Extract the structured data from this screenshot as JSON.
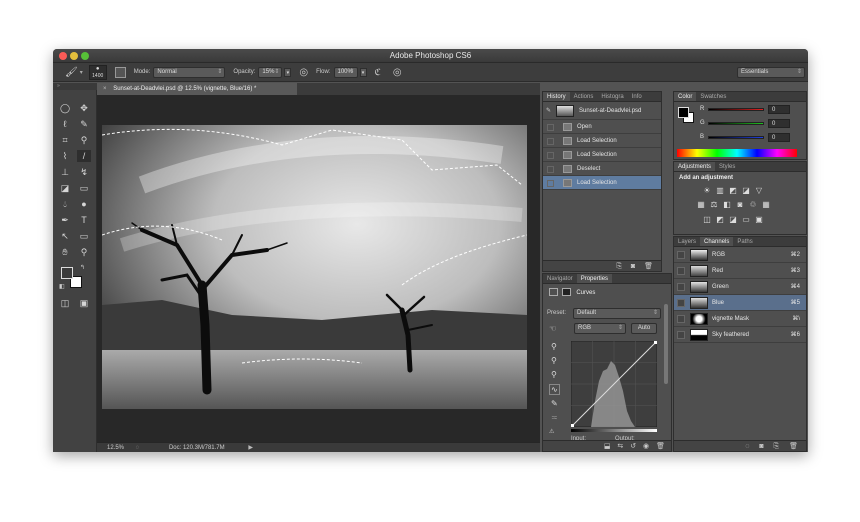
{
  "app": {
    "title": "Adobe Photoshop CS6"
  },
  "options": {
    "brush_size": "1400",
    "mode_label": "Mode:",
    "mode_value": "Normal",
    "opacity_label": "Opacity:",
    "opacity_value": "15%",
    "flow_label": "Flow:",
    "flow_value": "100%",
    "workspace": "Essentials"
  },
  "document": {
    "tab_title": "Sunset-at-Deadvlei.psd @ 12.5% (vignette, Blue/16) *",
    "close_glyph": "×"
  },
  "status": {
    "zoom": "12.5%",
    "doc_info": "Doc: 120.3M/781.7M"
  },
  "history": {
    "tabs": [
      "History",
      "Actions",
      "Histogra",
      "Info"
    ],
    "snapshot": "Sunset-at-Deadvlei.psd",
    "items": [
      "Open",
      "Load Selection",
      "Load Selection",
      "Deselect",
      "Load Selection"
    ],
    "selected_index": 4
  },
  "properties": {
    "tabs": [
      "Navigator",
      "Properties"
    ],
    "title": "Curves",
    "preset_label": "Preset:",
    "preset_value": "Default",
    "channel_value": "RGB",
    "auto_label": "Auto",
    "input_label": "Input:",
    "output_label": "Output:"
  },
  "color": {
    "tabs": [
      "Color",
      "Swatches"
    ],
    "channels": [
      {
        "label": "R",
        "value": "0",
        "color": "#e02020"
      },
      {
        "label": "G",
        "value": "0",
        "color": "#20c020"
      },
      {
        "label": "B",
        "value": "0",
        "color": "#2040e0"
      }
    ]
  },
  "adjustments": {
    "tabs": [
      "Adjustments",
      "Styles"
    ],
    "heading": "Add an adjustment"
  },
  "channels": {
    "tabs": [
      "Layers",
      "Channels",
      "Paths"
    ],
    "items": [
      {
        "name": "RGB",
        "shortcut": "⌘2"
      },
      {
        "name": "Red",
        "shortcut": "⌘3"
      },
      {
        "name": "Green",
        "shortcut": "⌘4"
      },
      {
        "name": "Blue",
        "shortcut": "⌘5"
      },
      {
        "name": "vignette Mask",
        "shortcut": "⌘\\"
      },
      {
        "name": "Sky feathered",
        "shortcut": "⌘6"
      }
    ],
    "selected_index": 3
  }
}
